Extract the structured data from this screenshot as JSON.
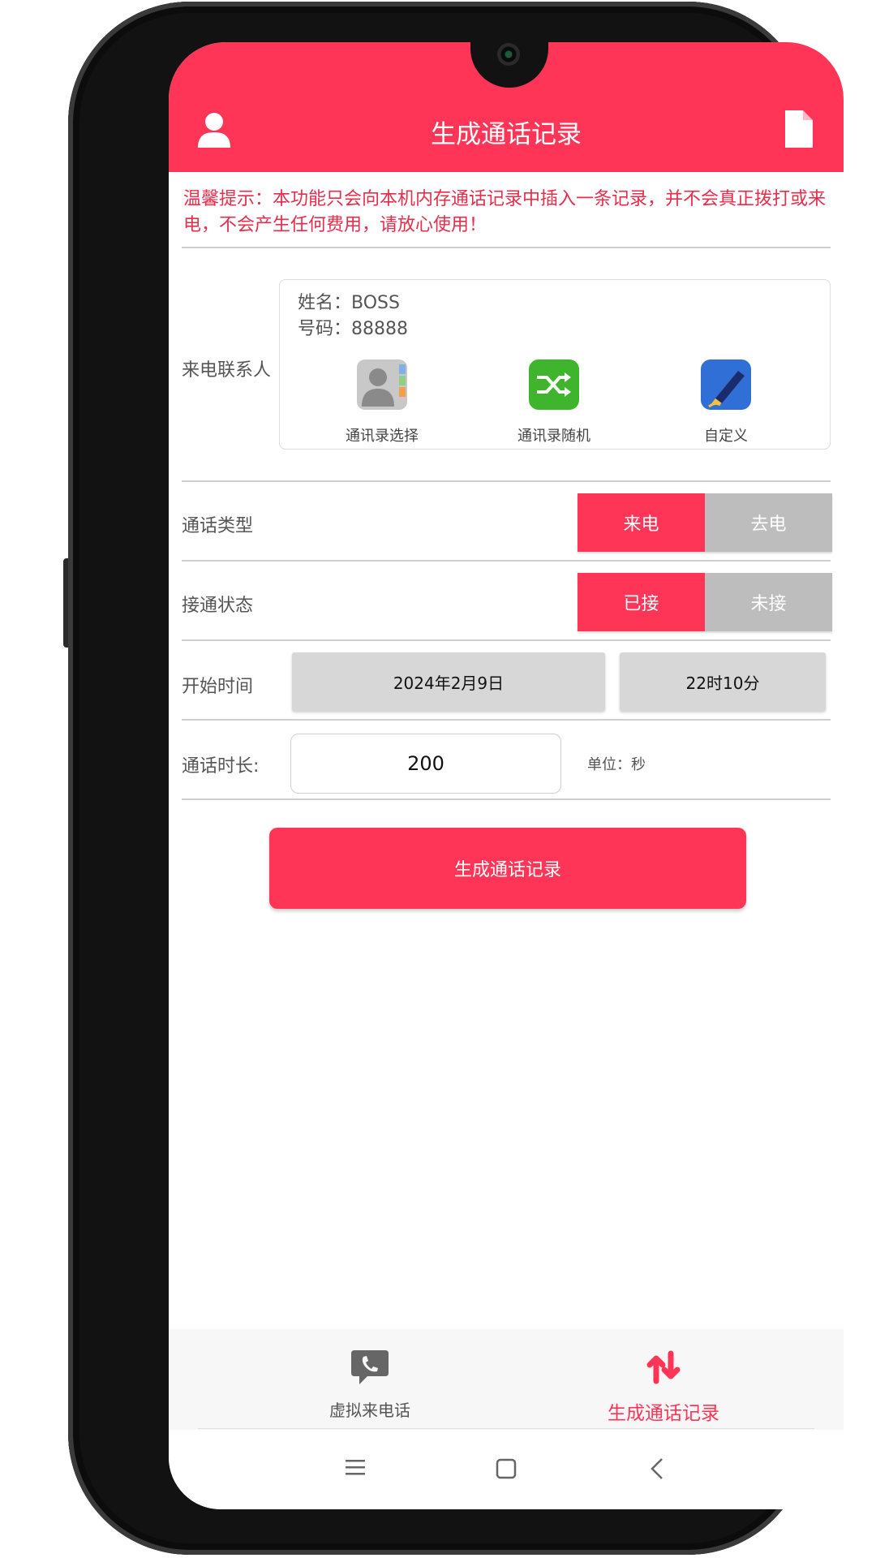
{
  "header": {
    "title": "生成通话记录",
    "left_icon": "user-icon",
    "right_icon": "document-icon",
    "color": "#fe3556"
  },
  "tip": "温馨提示：本功能只会向本机内存通话记录中插入一条记录，并不会真正拨打或来电，不会产生任何费用，请放心使用！",
  "contact": {
    "label": "来电联系人",
    "name": "姓名：BOSS",
    "number": "号码：88888",
    "actions": [
      {
        "label": "通讯录选择",
        "icon": "contacts-book-icon"
      },
      {
        "label": "通讯录随机",
        "icon": "shuffle-icon"
      },
      {
        "label": "自定义",
        "icon": "pen-icon"
      }
    ]
  },
  "call_type": {
    "label": "通话类型",
    "options": [
      "来电",
      "去电"
    ],
    "selected": "来电"
  },
  "connect_status": {
    "label": "接通状态",
    "options": [
      "已接",
      "未接"
    ],
    "selected": "已接"
  },
  "start_time": {
    "label": "开始时间",
    "date": "2024年2月9日",
    "time": "22时10分"
  },
  "duration": {
    "label": "通话时长:",
    "value": "200",
    "unit": "单位：秒"
  },
  "generate_button": "生成通话记录",
  "tabs": [
    {
      "label": "虚拟来电话",
      "icon": "phone-chat-icon",
      "active": false
    },
    {
      "label": "生成通话记录",
      "icon": "swap-arrows-icon",
      "active": true
    }
  ],
  "nav": [
    "menu-icon",
    "home-icon",
    "back-icon"
  ]
}
